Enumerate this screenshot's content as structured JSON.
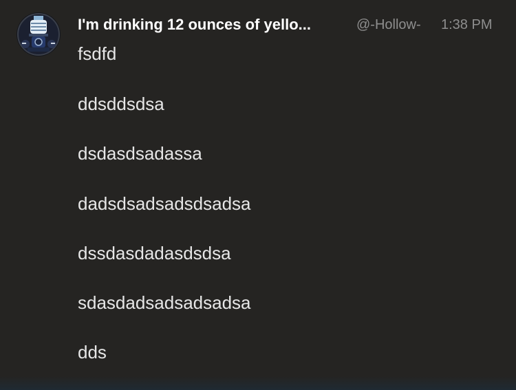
{
  "message": {
    "display_name": "I'm drinking 12 ounces of yello...",
    "handle": "@-Hollow-",
    "timestamp": "1:38 PM",
    "avatar_icon": "lantern-avatar-icon",
    "lines": [
      "fsdfd",
      "ddsddsdsa",
      "dsdasdsadassa",
      "dadsdsadsadsdsadsa",
      "dssdasdadasdsdsa",
      "sdasdadsadsadsadsa",
      "dds"
    ]
  },
  "colors": {
    "background": "#252422",
    "name": "#ffffff",
    "meta": "#8e8e8e",
    "body_text": "#e6e6e6"
  }
}
